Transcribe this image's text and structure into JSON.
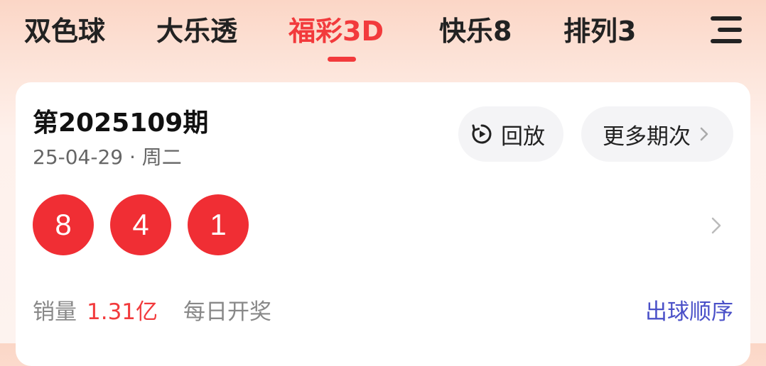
{
  "tabs": [
    {
      "label": "双色球"
    },
    {
      "label": "大乐透"
    },
    {
      "label": "福彩3D",
      "active": true
    },
    {
      "label": "快乐8"
    },
    {
      "label": "排列3"
    }
  ],
  "icons": {
    "menu": "menu-icon",
    "replay": "replay-icon",
    "chevron": "chevron-right-icon"
  },
  "colors": {
    "accent": "#f23a3c",
    "ball": "#f02e34",
    "link": "#4a50c8"
  },
  "card": {
    "issue": "第2025109期",
    "date": "25-04-29 · 周二",
    "replay_label": "回放",
    "more_label": "更多期次",
    "balls": [
      "8",
      "4",
      "1"
    ],
    "sales_label": "销量",
    "sales_value": "1.31亿",
    "draw_frequency": "每日开奖",
    "order_link": "出球顺序"
  }
}
